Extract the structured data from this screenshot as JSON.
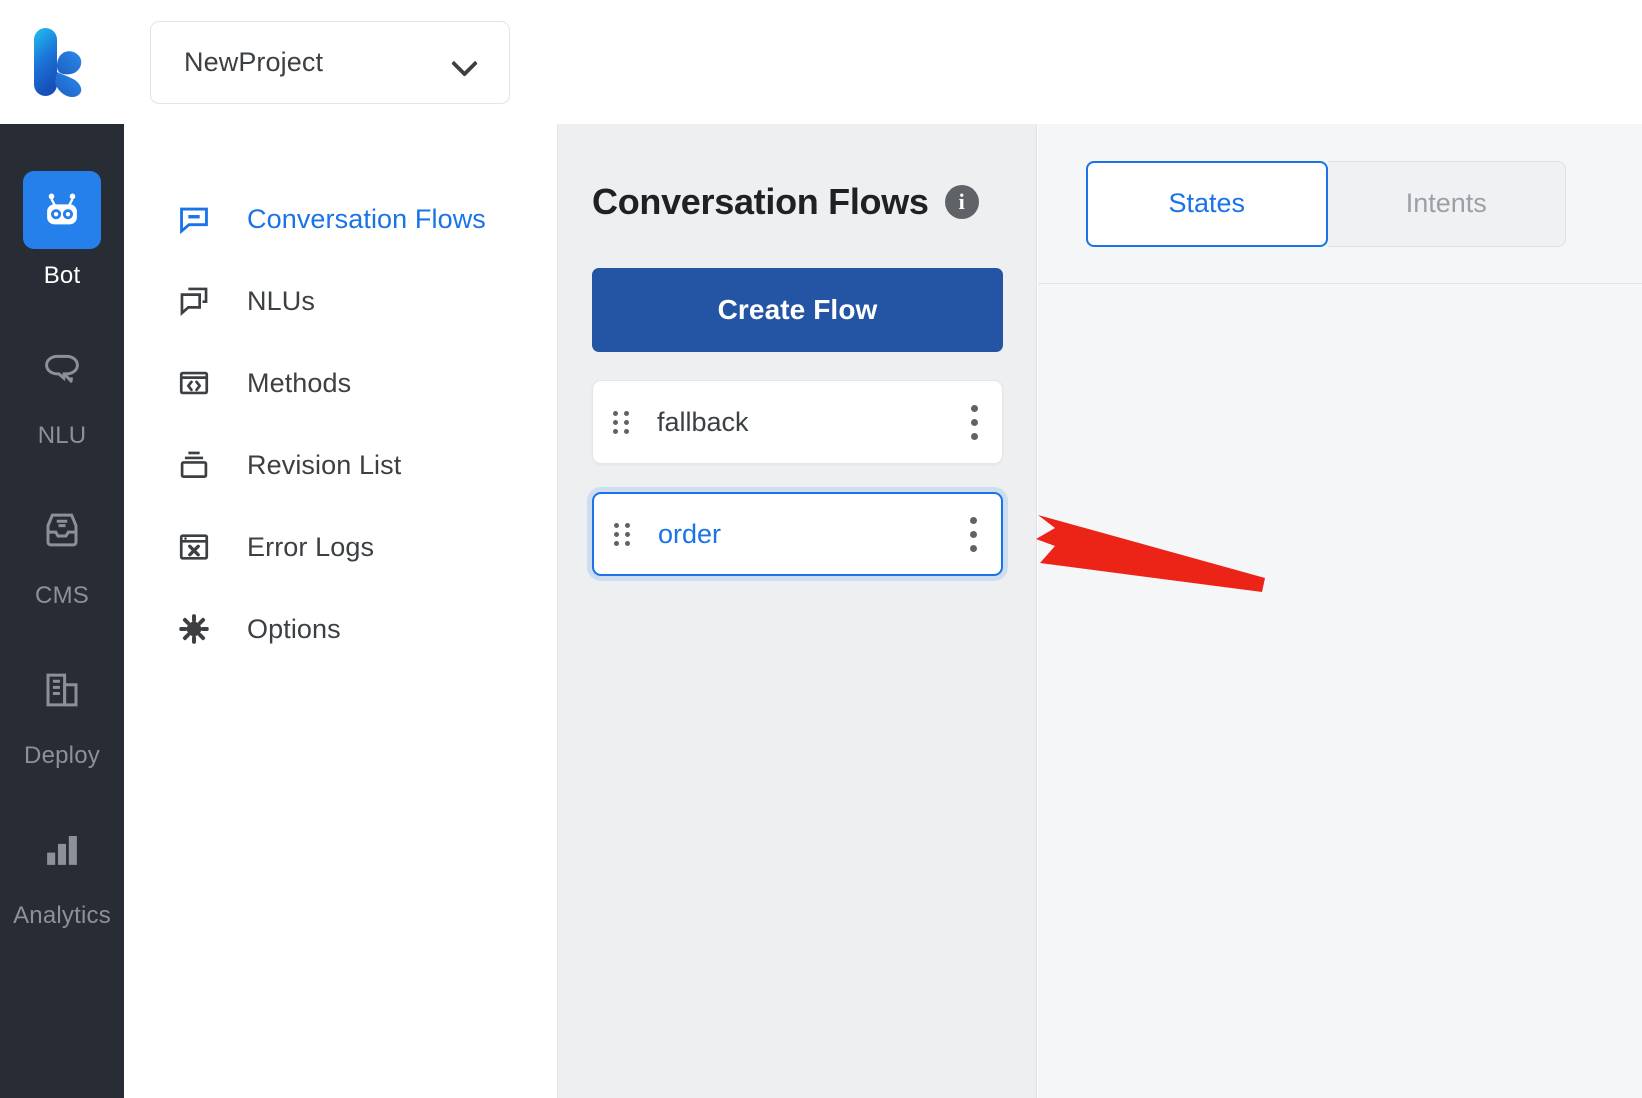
{
  "header": {
    "logo_name": "kotodama-k-logo",
    "project": {
      "value": "NewProject",
      "dropdown_icon": "chevron-down-icon"
    }
  },
  "rail": {
    "items": [
      {
        "label": "Bot",
        "icon": "robot-icon",
        "active": true
      },
      {
        "label": "NLU",
        "icon": "chat-bubble-icon",
        "active": false
      },
      {
        "label": "CMS",
        "icon": "inbox-tray-icon",
        "active": false
      },
      {
        "label": "Deploy",
        "icon": "building-icon",
        "active": false
      },
      {
        "label": "Analytics",
        "icon": "bar-chart-icon",
        "active": false
      }
    ]
  },
  "subnav": {
    "items": [
      {
        "label": "Conversation Flows",
        "icon": "speech-square-icon",
        "active": true
      },
      {
        "label": "NLUs",
        "icon": "chat-stack-icon",
        "active": false
      },
      {
        "label": "Methods",
        "icon": "code-window-icon",
        "active": false
      },
      {
        "label": "Revision List",
        "icon": "archive-box-icon",
        "active": false
      },
      {
        "label": "Error Logs",
        "icon": "error-window-icon",
        "active": false
      },
      {
        "label": "Options",
        "icon": "gear-icon",
        "active": false
      }
    ]
  },
  "flows_panel": {
    "title": "Conversation Flows",
    "info_icon": "info-icon",
    "info_glyph": "i",
    "create_button": "Create Flow",
    "flows": [
      {
        "name": "fallback",
        "selected": false,
        "drag_icon": "drag-handle-icon",
        "menu_icon": "kebab-menu-icon"
      },
      {
        "name": "order",
        "selected": true,
        "drag_icon": "drag-handle-icon",
        "menu_icon": "kebab-menu-icon"
      }
    ]
  },
  "right_panel": {
    "tabs": [
      {
        "label": "States",
        "active": true
      },
      {
        "label": "Intents",
        "active": false
      }
    ],
    "content": ""
  },
  "annotation": {
    "arrow_name": "red-pointer-arrow",
    "color": "#ec2418",
    "points_to": "order"
  },
  "colors": {
    "accent_blue": "#1a73e8",
    "button_blue": "#2455a4",
    "rail_bg": "#282c34",
    "rail_active": "#2680eb",
    "panel_bg": "#edeff1",
    "right_bg": "#f4f6f8",
    "annotation_red": "#ec2418"
  }
}
